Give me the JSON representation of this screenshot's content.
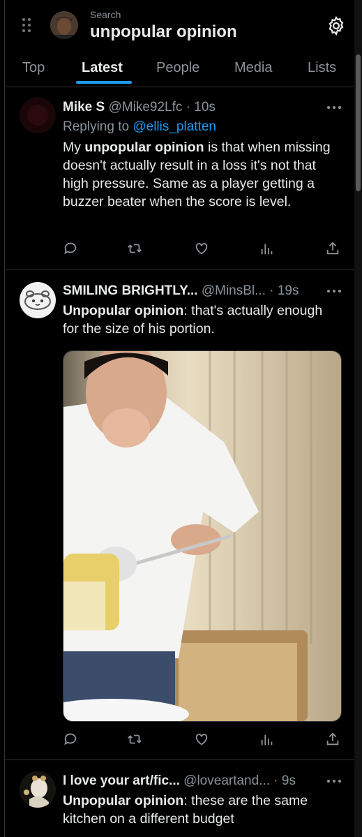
{
  "header": {
    "search_label": "Search",
    "query": "unpopular opinion",
    "icons": [
      "drag-handle-icon",
      "settings-gear-icon"
    ]
  },
  "tabs": [
    {
      "label": "Top",
      "active": false
    },
    {
      "label": "Latest",
      "active": true
    },
    {
      "label": "People",
      "active": false
    },
    {
      "label": "Media",
      "active": false
    },
    {
      "label": "Lists",
      "active": false
    }
  ],
  "tweets": [
    {
      "name": "Mike S",
      "meta": "@Mike92Lfc · 10s",
      "replying_label": "Replying to",
      "replying_handle": "@ellis_platten",
      "body_pre": "My",
      "body_bold": "unpopular opinion",
      "body_post": "is that when missing doesn't actually result in a loss it's not that high pressure. Same as a player getting a buzzer beater when the score is level."
    },
    {
      "name": "SMILING BRIGHTLY...",
      "meta": "@MinsBl... · 19s",
      "body_bold": "Unpopular opinion",
      "body_post": ": that's actually enough for the size of his portion."
    },
    {
      "name": "I love your art/fic...",
      "meta": "@loveartand... · 9s",
      "body_bold": "Unpopular opinion",
      "body_post": ": these are the same kitchen on a different budget"
    }
  ],
  "action_icons": [
    "reply-icon",
    "retweet-icon",
    "like-icon",
    "views-icon",
    "share-icon"
  ],
  "colors": {
    "background": "#000000",
    "accent": "#1d9bf0",
    "text": "#e7e9ea",
    "muted": "#8b9399",
    "border": "#2f3336"
  }
}
